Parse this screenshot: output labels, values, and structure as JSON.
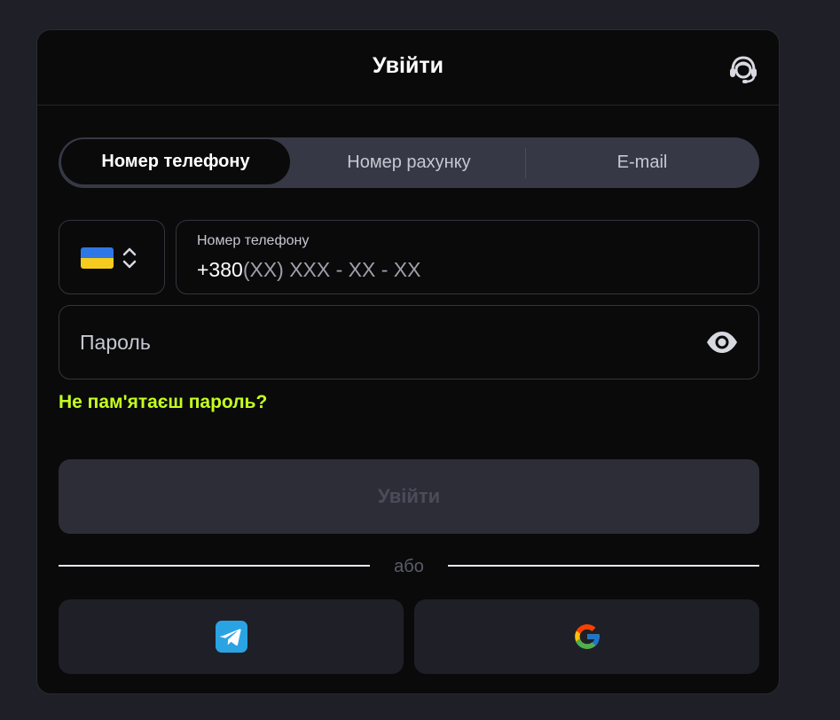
{
  "header": {
    "title": "Увійти",
    "support_icon": "headset-icon"
  },
  "tabs": [
    {
      "label": "Номер телефону",
      "active": true
    },
    {
      "label": "Номер рахунку",
      "active": false
    },
    {
      "label": "E-mail",
      "active": false
    }
  ],
  "country": {
    "flag": "ukraine-flag-icon",
    "selector_icon": "chevron-up-down-icon"
  },
  "phone": {
    "label": "Номер телефону",
    "prefix": "+380",
    "mask": "(XX) XXX - XX - XX"
  },
  "password": {
    "placeholder": "Пароль",
    "toggle_icon": "eye-icon"
  },
  "forgot_password": "Не пам'ятаєш пароль?",
  "submit_label": "Увійти",
  "divider_text": "або",
  "social": [
    {
      "name": "telegram",
      "icon": "telegram-icon"
    },
    {
      "name": "google",
      "icon": "google-icon"
    }
  ],
  "colors": {
    "page_bg": "#1f1f27",
    "modal_bg": "#0a0a0b",
    "accent": "#c5ff1f",
    "telegram": "#2aa3e3"
  }
}
